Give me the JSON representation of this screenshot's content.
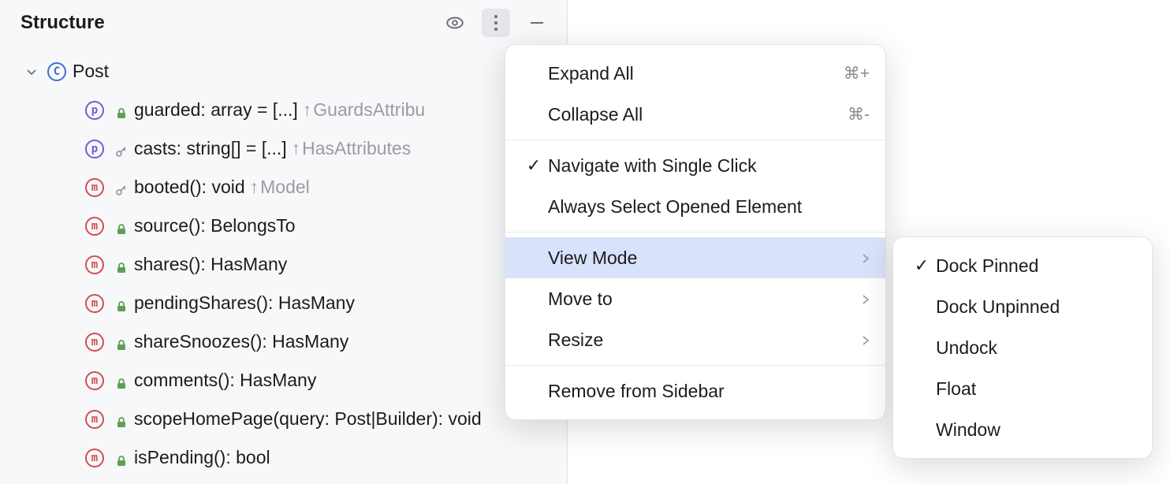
{
  "panel": {
    "title": "Structure"
  },
  "tree": {
    "root_label": "Post",
    "members": [
      {
        "kind": "p",
        "access": "lock-green",
        "text": "guarded: array = [...]",
        "inherit": "GuardsAttribu"
      },
      {
        "kind": "p",
        "access": "key",
        "text": "casts: string[] = [...]",
        "inherit": "HasAttributes"
      },
      {
        "kind": "m",
        "access": "key",
        "text": "booted(): void",
        "inherit": "Model"
      },
      {
        "kind": "m",
        "access": "lock-green",
        "text": "source(): BelongsTo",
        "inherit": ""
      },
      {
        "kind": "m",
        "access": "lock-green",
        "text": "shares(): HasMany",
        "inherit": ""
      },
      {
        "kind": "m",
        "access": "lock-green",
        "text": "pendingShares(): HasMany",
        "inherit": ""
      },
      {
        "kind": "m",
        "access": "lock-green",
        "text": "shareSnoozes(): HasMany",
        "inherit": ""
      },
      {
        "kind": "m",
        "access": "lock-green",
        "text": "comments(): HasMany",
        "inherit": ""
      },
      {
        "kind": "m",
        "access": "lock-green",
        "text": "scopeHomePage(query: Post|Builder): void",
        "inherit": ""
      },
      {
        "kind": "m",
        "access": "lock-green",
        "text": "isPending(): bool",
        "inherit": ""
      }
    ]
  },
  "menu": {
    "expand_all": "Expand All",
    "expand_all_shortcut": "⌘+",
    "collapse_all": "Collapse All",
    "collapse_all_shortcut": "⌘-",
    "navigate_single_click": "Navigate with Single Click",
    "always_select_opened": "Always Select Opened Element",
    "view_mode": "View Mode",
    "move_to": "Move to",
    "resize": "Resize",
    "remove_from_sidebar": "Remove from Sidebar"
  },
  "submenu": {
    "dock_pinned": "Dock Pinned",
    "dock_unpinned": "Dock Unpinned",
    "undock": "Undock",
    "float": "Float",
    "window": "Window"
  }
}
